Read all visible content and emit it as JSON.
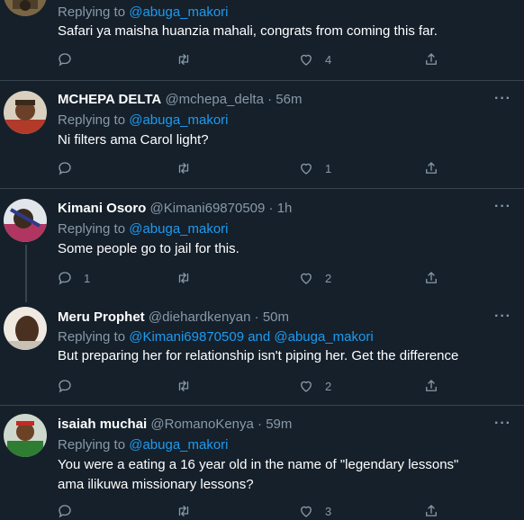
{
  "tweets": [
    {
      "replying_prefix": "Replying to",
      "replying_to": "@abuga_makori",
      "text": "Safari ya maisha huanzia mahali, congrats from coming this far.",
      "reply_count": "",
      "retweet_count": "",
      "like_count": "4"
    },
    {
      "name": "MCHEPA DELTA",
      "handle": "@mchepa_delta",
      "time": "· 56m",
      "replying_prefix": "Replying to",
      "replying_to": "@abuga_makori",
      "text": "Ni filters ama Carol light?",
      "reply_count": "",
      "retweet_count": "",
      "like_count": "1"
    },
    {
      "name": "Kimani Osoro",
      "handle": "@Kimani69870509",
      "time": "· 1h",
      "replying_prefix": "Replying to",
      "replying_to": "@abuga_makori",
      "text": "Some people go to jail for this.",
      "reply_count": "1",
      "retweet_count": "",
      "like_count": "2"
    },
    {
      "name": "Meru Prophet",
      "handle": "@diehardkenyan",
      "time": "· 50m",
      "replying_prefix": "Replying to",
      "replying_to": "@Kimani69870509 and @abuga_makori",
      "text": "But preparing her for relationship isn't piping her. Get the difference",
      "reply_count": "",
      "retweet_count": "",
      "like_count": "2"
    },
    {
      "name": "isaiah muchai",
      "handle": "@RomanoKenya",
      "time": "· 59m",
      "replying_prefix": "Replying to",
      "replying_to": "@abuga_makori",
      "text": "You were a eating a 16 year old in the name of \"legendary lessons\" ama ilikuwa missionary lessons?",
      "reply_count": "",
      "retweet_count": "",
      "like_count": "3"
    }
  ],
  "icons": {
    "reply": "reply-icon",
    "retweet": "retweet-icon",
    "like": "heart-icon",
    "share": "share-icon",
    "more": "more-options-icon"
  },
  "colors": {
    "background": "#15202b",
    "link": "#1d9bf0",
    "muted": "#8899a6",
    "divider": "#38444d"
  }
}
